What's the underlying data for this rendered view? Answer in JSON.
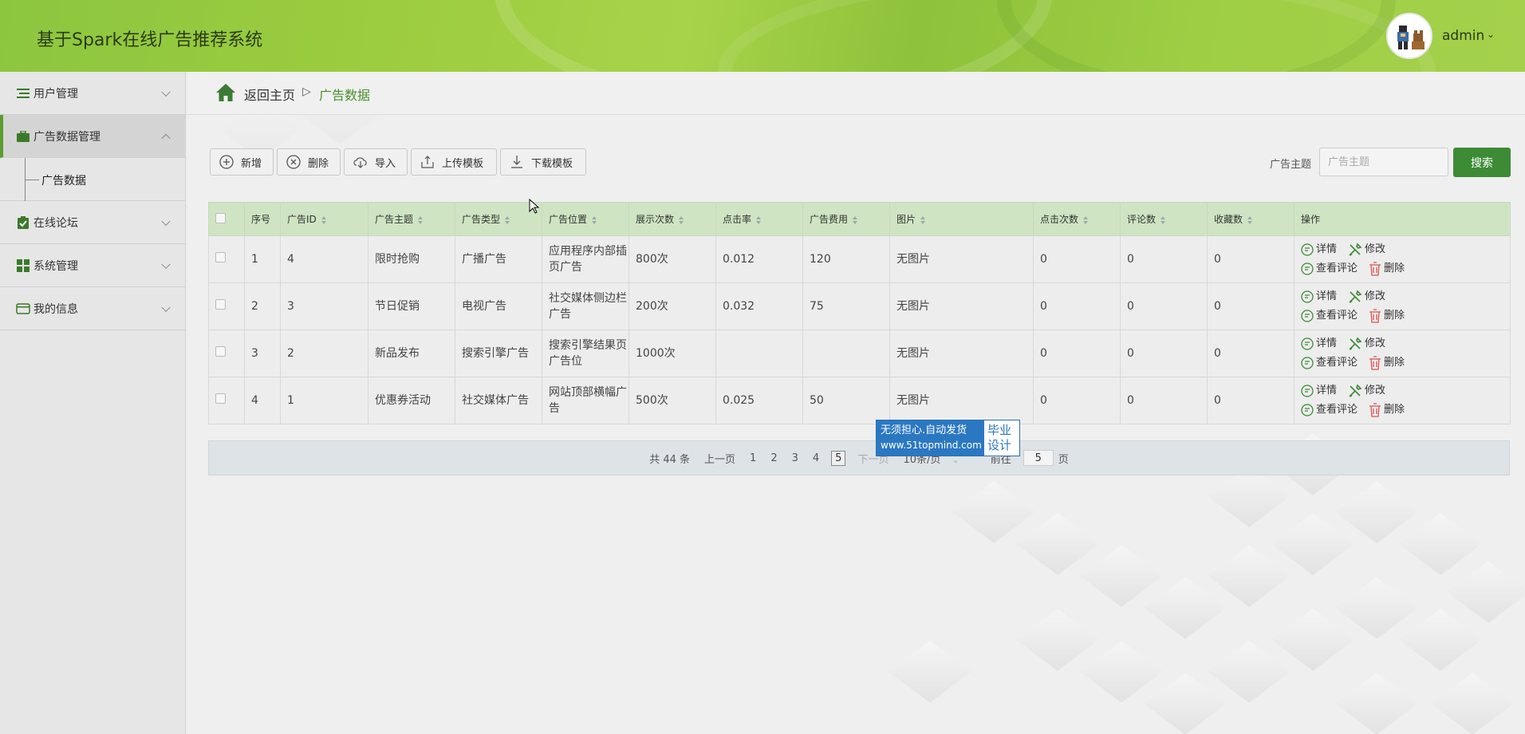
{
  "header": {
    "title": "基于Spark在线广告推荐系统",
    "user_name": "admin",
    "accent_color": "#8cc63f"
  },
  "sidebar": {
    "items": [
      {
        "label": "用户管理",
        "icon": "list-icon"
      },
      {
        "label": "广告数据管理",
        "icon": "briefcase-icon",
        "active": true,
        "expanded": true
      },
      {
        "label": "在线论坛",
        "icon": "clipboard-check-icon"
      },
      {
        "label": "系统管理",
        "icon": "grid-icon"
      },
      {
        "label": "我的信息",
        "icon": "id-card-icon"
      }
    ],
    "submenu": {
      "label": "广告数据"
    }
  },
  "breadcrumb": {
    "home": "返回主页",
    "separator": "▷",
    "current": "广告数据"
  },
  "toolbar": {
    "add": "新增",
    "delete": "删除",
    "import": "导入",
    "upload_template": "上传模板",
    "download_template": "下载模板"
  },
  "search": {
    "label": "广告主题",
    "placeholder": "广告主题",
    "button": "搜索"
  },
  "table": {
    "columns": [
      "序号",
      "广告ID",
      "广告主题",
      "广告类型",
      "广告位置",
      "展示次数",
      "点击率",
      "广告费用",
      "图片",
      "点击次数",
      "评论数",
      "收藏数",
      "操作"
    ],
    "rows": [
      {
        "no": "1",
        "id": "4",
        "topic": "限时抢购",
        "type": "广播广告",
        "position": "应用程序内部插页广告",
        "views": "800次",
        "ctr": "0.012",
        "cost": "120",
        "image": "无图片",
        "clicks": "0",
        "comments": "0",
        "favorites": "0"
      },
      {
        "no": "2",
        "id": "3",
        "topic": "节日促销",
        "type": "电视广告",
        "position": "社交媒体侧边栏广告",
        "views": "200次",
        "ctr": "0.032",
        "cost": "75",
        "image": "无图片",
        "clicks": "0",
        "comments": "0",
        "favorites": "0"
      },
      {
        "no": "3",
        "id": "2",
        "topic": "新品发布",
        "type": "搜索引擎广告",
        "position": "搜索引擎结果页广告位",
        "views": "1000次",
        "ctr": "",
        "cost": "",
        "image": "无图片",
        "clicks": "0",
        "comments": "0",
        "favorites": "0"
      },
      {
        "no": "4",
        "id": "1",
        "topic": "优惠券活动",
        "type": "社交媒体广告",
        "position": "网站顶部横幅广告",
        "views": "500次",
        "ctr": "0.025",
        "cost": "50",
        "image": "无图片",
        "clicks": "0",
        "comments": "0",
        "favorites": "0"
      }
    ],
    "actions": {
      "detail": "详情",
      "edit": "修改",
      "view_comments": "查看评论",
      "delete": "删除"
    }
  },
  "pagination": {
    "total": "共 44 条",
    "prev": "上一页",
    "pages": [
      "1",
      "2",
      "3",
      "4",
      "5"
    ],
    "current": "5",
    "next": "下一页",
    "page_size": "10条/页",
    "goto_label": "前往",
    "goto_value": "5",
    "goto_suffix": "页"
  },
  "watermark": {
    "line1": "无须担心.自动发货",
    "line2": "www.51topmind.com",
    "right1": "毕业",
    "right2": "设计"
  }
}
